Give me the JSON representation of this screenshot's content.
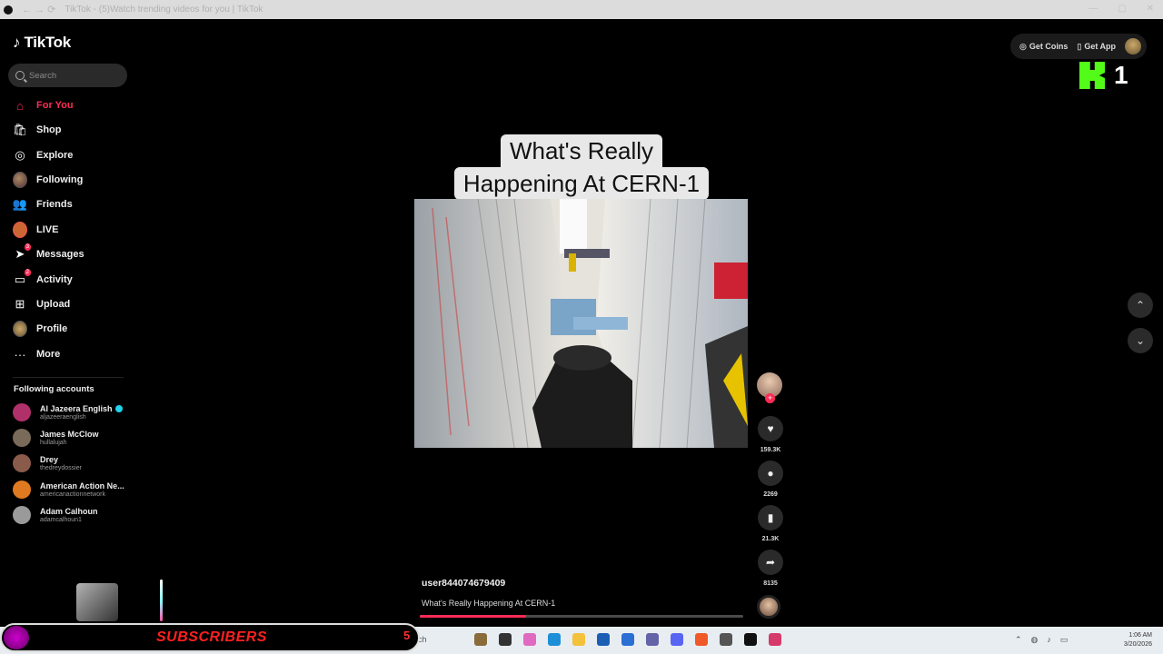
{
  "browser": {
    "tab_title": "TikTok - (5)Watch trending videos for you | TikTok",
    "nav_symbols": "←  →  ⟳"
  },
  "sidebar": {
    "logo_text": "TikTok",
    "search_placeholder": "Search",
    "items": [
      {
        "label": "For You",
        "icon": "home-icon",
        "active": true
      },
      {
        "label": "Shop",
        "icon": "shop-bag-icon"
      },
      {
        "label": "Explore",
        "icon": "compass-icon"
      },
      {
        "label": "Following",
        "icon": "following-avatar-icon"
      },
      {
        "label": "Friends",
        "icon": "friends-icon"
      },
      {
        "label": "LIVE",
        "icon": "live-icon"
      },
      {
        "label": "Messages",
        "icon": "messages-icon",
        "badge": "3"
      },
      {
        "label": "Activity",
        "icon": "activity-icon",
        "badge": "2"
      },
      {
        "label": "Upload",
        "icon": "upload-icon"
      },
      {
        "label": "Profile",
        "icon": "profile-icon"
      },
      {
        "label": "More",
        "icon": "more-dots-icon"
      }
    ],
    "following_heading": "Following accounts",
    "accounts": [
      {
        "name": "Al Jazeera English",
        "handle": "aljazeeraenglish",
        "verified": true,
        "color": "#b0306a"
      },
      {
        "name": "James McClow",
        "handle": "hullalujah",
        "color": "#7a6a5a"
      },
      {
        "name": "Drey",
        "handle": "thedreydossier",
        "color": "#8a5a4a"
      },
      {
        "name": "American Action Ne...",
        "handle": "americanactionnetwork",
        "color": "#e07a20"
      },
      {
        "name": "Adam Calhoun",
        "handle": "adamcalhoun1",
        "color": "#9a9a9a"
      }
    ]
  },
  "header": {
    "get_coins": "Get Coins",
    "get_app": "Get App"
  },
  "kick_overlay": {
    "letter": "K",
    "count": "1"
  },
  "video": {
    "caption_line1": "What's Really",
    "caption_line2": "Happening At CERN-1",
    "author": "user844074679409",
    "description": "What's Really Happening At CERN-1",
    "progress": 0.33
  },
  "actions": {
    "likes": "159.3K",
    "comments": "2269",
    "saves": "21.3K",
    "shares": "8135"
  },
  "stream_overlay": {
    "subscribers_label": "SUBSCRIBERS",
    "subscribers_count": "5"
  },
  "taskbar": {
    "search_text": "ch",
    "time": "1:06 AM",
    "date": "3/20/2026"
  },
  "colors": {
    "accent": "#fe2c55",
    "background": "#000000",
    "kick_green": "#53fc18"
  }
}
